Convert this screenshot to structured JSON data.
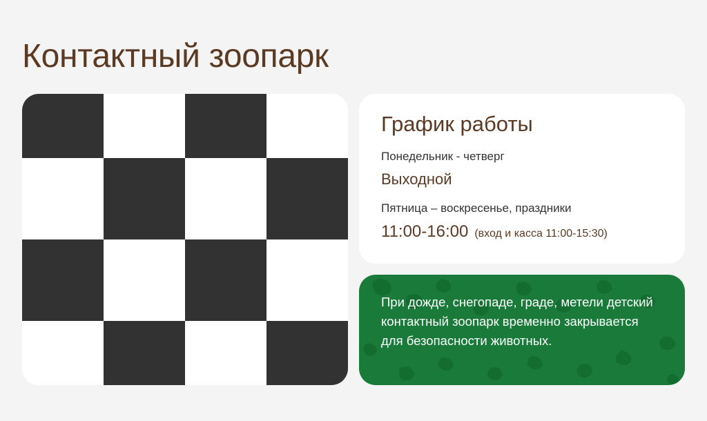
{
  "page": {
    "title": "Контактный зоопарк"
  },
  "image": {
    "checker": [
      [
        1,
        0,
        1,
        0
      ],
      [
        0,
        1,
        0,
        1
      ],
      [
        1,
        0,
        1,
        0
      ],
      [
        0,
        1,
        0,
        1
      ]
    ]
  },
  "schedule": {
    "title": "График работы",
    "weekdays_label": "Понедельник - четверг",
    "weekdays_value": "Выходной",
    "weekend_label": "Пятница – воскресенье, праздники",
    "weekend_hours": "11:00-16:00",
    "weekend_note": "(вход и касса 11:00-15:30)"
  },
  "warning": {
    "text": "При дожде, снегопаде, граде, метели детский контактный зоопарк временно закрывается для безопасности животных."
  },
  "colors": {
    "title": "#5b3a24",
    "checker_dark": "#323232",
    "warning_bg": "#1a7a3a",
    "warning_spots": "#136a30"
  }
}
